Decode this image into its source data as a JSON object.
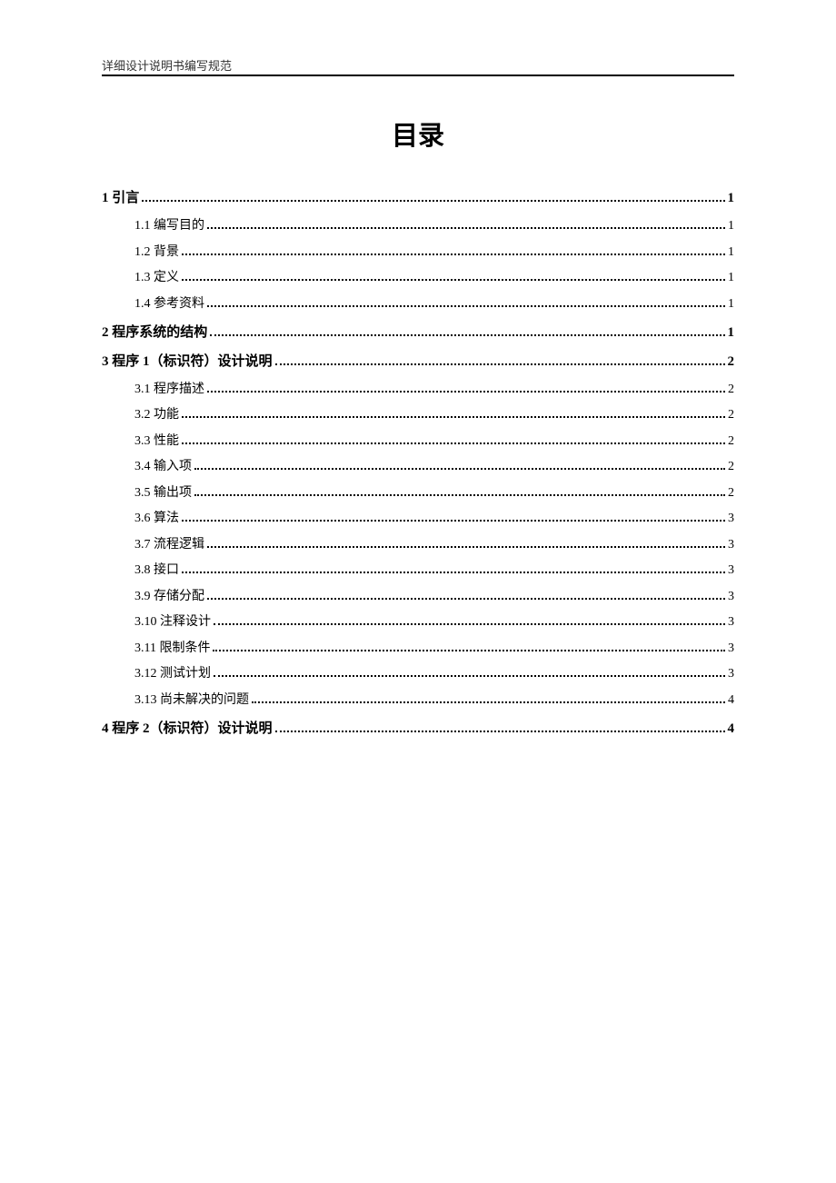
{
  "header": "详细设计说明书编写规范",
  "title": "目录",
  "toc": [
    {
      "level": 1,
      "num": "1",
      "label": "引言",
      "page": "1"
    },
    {
      "level": 2,
      "num": "1.1",
      "label": "编写目的",
      "page": "1"
    },
    {
      "level": 2,
      "num": "1.2",
      "label": "背景",
      "page": "1"
    },
    {
      "level": 2,
      "num": "1.3",
      "label": "定义",
      "page": "1"
    },
    {
      "level": 2,
      "num": "1.4",
      "label": "参考资料",
      "page": "1"
    },
    {
      "level": 1,
      "num": "2",
      "label": "程序系统的结构",
      "page": "1"
    },
    {
      "level": 1,
      "num": "3",
      "label": "程序 1（标识符）设计说明",
      "page": "2"
    },
    {
      "level": 2,
      "num": "3.1",
      "label": "程序描述",
      "page": "2"
    },
    {
      "level": 2,
      "num": "3.2",
      "label": "功能",
      "page": "2"
    },
    {
      "level": 2,
      "num": "3.3",
      "label": "性能",
      "page": "2"
    },
    {
      "level": 2,
      "num": "3.4",
      "label": "输入项",
      "page": "2"
    },
    {
      "level": 2,
      "num": "3.5",
      "label": "输出项",
      "page": "2"
    },
    {
      "level": 2,
      "num": "3.6",
      "label": "算法",
      "page": "3"
    },
    {
      "level": 2,
      "num": "3.7",
      "label": "流程逻辑",
      "page": "3"
    },
    {
      "level": 2,
      "num": "3.8",
      "label": "接口",
      "page": "3"
    },
    {
      "level": 2,
      "num": "3.9",
      "label": "存储分配",
      "page": "3"
    },
    {
      "level": 2,
      "num": "3.10",
      "label": "注释设计",
      "page": "3"
    },
    {
      "level": 2,
      "num": "3.11",
      "label": "限制条件",
      "page": "3"
    },
    {
      "level": 2,
      "num": "3.12",
      "label": "测试计划",
      "page": "3"
    },
    {
      "level": 2,
      "num": "3.13",
      "label": "尚未解决的问题",
      "page": "4"
    },
    {
      "level": 1,
      "num": "4",
      "label": "程序 2（标识符）设计说明",
      "page": "4"
    }
  ]
}
